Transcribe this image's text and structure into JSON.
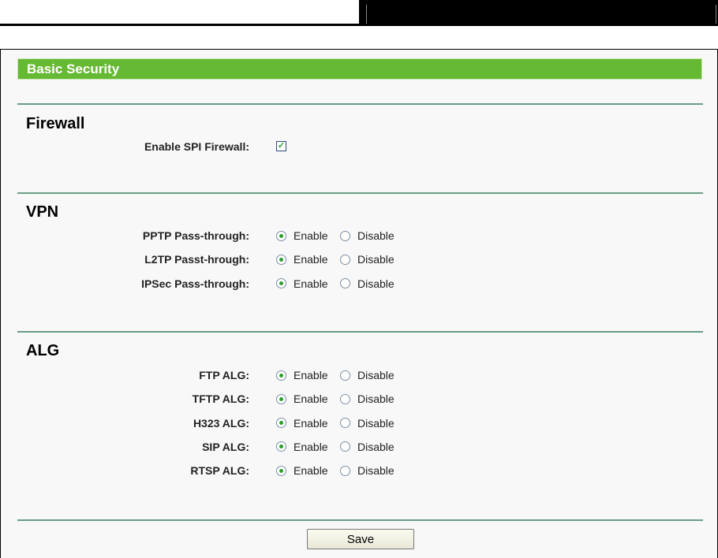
{
  "header": {
    "title": "Basic Security"
  },
  "firewall": {
    "title": "Firewall",
    "spi_label": "Enable SPI Firewall:",
    "spi_checked": true,
    "check_glyph": "✓"
  },
  "vpn": {
    "title": "VPN",
    "rows": [
      {
        "label": "PPTP Pass-through:",
        "enable": "Enable",
        "disable": "Disable",
        "selected": "enable"
      },
      {
        "label": "L2TP Passt-hrough:",
        "enable": "Enable",
        "disable": "Disable",
        "selected": "enable"
      },
      {
        "label": "IPSec Pass-through:",
        "enable": "Enable",
        "disable": "Disable",
        "selected": "enable"
      }
    ]
  },
  "alg": {
    "title": "ALG",
    "rows": [
      {
        "label": "FTP ALG:",
        "enable": "Enable",
        "disable": "Disable",
        "selected": "enable"
      },
      {
        "label": "TFTP ALG:",
        "enable": "Enable",
        "disable": "Disable",
        "selected": "enable"
      },
      {
        "label": "H323 ALG:",
        "enable": "Enable",
        "disable": "Disable",
        "selected": "enable"
      },
      {
        "label": "SIP ALG:",
        "enable": "Enable",
        "disable": "Disable",
        "selected": "enable"
      },
      {
        "label": "RTSP ALG:",
        "enable": "Enable",
        "disable": "Disable",
        "selected": "enable"
      }
    ]
  },
  "save_label": "Save",
  "colors": {
    "accent": "#66b933",
    "rule": "#6a9e85"
  }
}
